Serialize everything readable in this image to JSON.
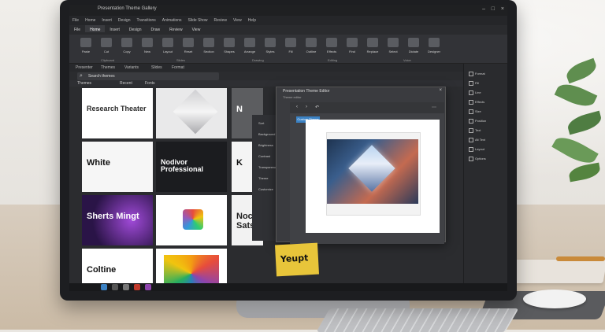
{
  "app": {
    "window_title": "Presentation Theme Gallery",
    "menu": [
      "File",
      "Home",
      "Insert",
      "Design",
      "Transitions",
      "Animations",
      "Slide Show",
      "Review",
      "View",
      "Help"
    ],
    "ribbon_tabs": [
      "File",
      "Home",
      "Insert",
      "Design",
      "Draw",
      "Review",
      "View"
    ],
    "active_tab": "Home",
    "ribbon_buttons": [
      "Paste",
      "Cut",
      "Copy",
      "New",
      "Layout",
      "Reset",
      "Section",
      "Shapes",
      "Arrange",
      "Styles",
      "Fill",
      "Outline",
      "Effects",
      "Find",
      "Replace",
      "Select",
      "Dictate",
      "Designer"
    ],
    "ribbon_groups": [
      "Clipboard",
      "Slides",
      "Drawing",
      "Editing",
      "Voice"
    ],
    "subbar": [
      "Presenter",
      "Themes",
      "Variants",
      "Slides",
      "Format"
    ],
    "search_placeholder": "Search themes",
    "strip": [
      "Themes",
      "Recent",
      "Fonts"
    ]
  },
  "gallery": {
    "themes": [
      {
        "title": "Research Theater",
        "bg": "#ffffff",
        "fg": "#2b2b2b"
      },
      {
        "title": "",
        "bg": "#e9e9ea",
        "fg": "#333"
      },
      {
        "title": "N",
        "bg": "#5c5d60",
        "fg": "#fff"
      },
      {
        "title": "White",
        "bg": "#f6f6f6",
        "fg": "#111"
      },
      {
        "title": "Nodivor Professional",
        "bg": "#1b1c1f",
        "fg": "#ffffff"
      },
      {
        "title": "K",
        "bg": "#f4f4f4",
        "fg": "#111"
      },
      {
        "title": "Sherts Mingt",
        "bg": "#3b1b5a",
        "fg": "#ffffff"
      },
      {
        "title": "",
        "bg": "#ffffff",
        "fg": "#333"
      },
      {
        "title": "Noc Sats",
        "bg": "#f2f2f2",
        "fg": "#222"
      },
      {
        "title": "Coltine",
        "bg": "#ffffff",
        "fg": "#111"
      },
      {
        "title": "",
        "bg": "#ffffff",
        "fg": "#333"
      },
      {
        "title": "Yeupt",
        "bg": "#e8c53a",
        "fg": "#111"
      }
    ]
  },
  "dialog": {
    "title": "Presentation Theme Editor",
    "subtitle": "Theme editor",
    "active_tab": "Custom Theme",
    "left_items": [
      "Sort",
      "Background",
      "Brightness",
      "Contrast",
      "Transparency",
      "Theme",
      "Customize"
    ]
  },
  "right_panel": {
    "items": [
      "Format",
      "Fill",
      "Line",
      "Effects",
      "Size",
      "Position",
      "Text",
      "Alt Text",
      "Layout",
      "Options"
    ]
  },
  "colors": {
    "accent": "#3b82c4",
    "ui_dark": "#2b2c2f"
  }
}
